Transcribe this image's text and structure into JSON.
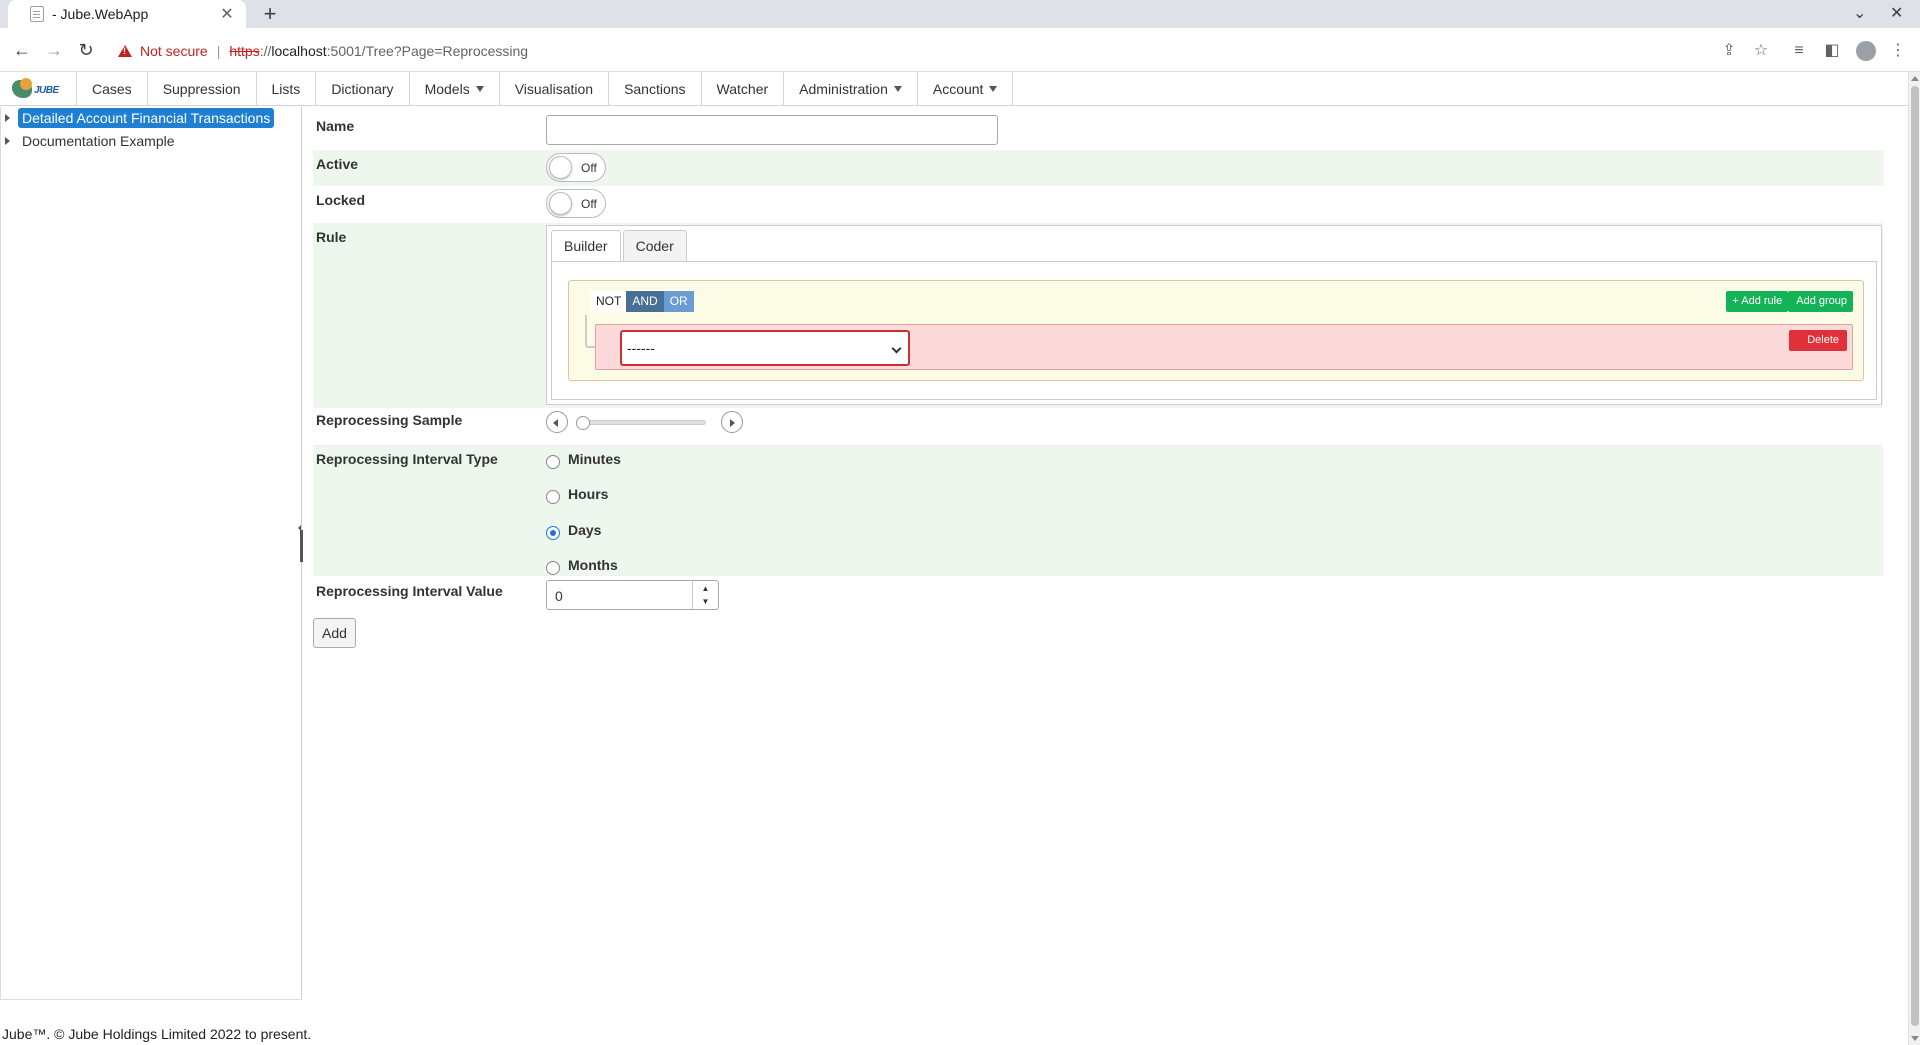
{
  "browser": {
    "tab_title": "- Jube.WebApp",
    "tab_close": "✕",
    "new_tab": "+",
    "security_label": "Not secure",
    "url_scheme": "https",
    "url_sep": "://",
    "url_host": "localhost",
    "url_path": ":5001/Tree?Page=Reprocessing"
  },
  "app": {
    "logo_text": "JUBE",
    "menu": [
      {
        "label": "Cases"
      },
      {
        "label": "Suppression"
      },
      {
        "label": "Lists"
      },
      {
        "label": "Dictionary"
      },
      {
        "label": "Models",
        "dropdown": true
      },
      {
        "label": "Visualisation"
      },
      {
        "label": "Sanctions"
      },
      {
        "label": "Watcher"
      },
      {
        "label": "Administration",
        "dropdown": true
      },
      {
        "label": "Account",
        "dropdown": true
      }
    ]
  },
  "tree": {
    "items": [
      {
        "label": "Detailed Account Financial Transactions",
        "selected": true
      },
      {
        "label": "Documentation Example",
        "selected": false
      }
    ]
  },
  "form": {
    "name": {
      "label": "Name",
      "value": ""
    },
    "active": {
      "label": "Active",
      "state": "Off"
    },
    "locked": {
      "label": "Locked",
      "state": "Off"
    },
    "rule": {
      "label": "Rule",
      "tabs": [
        "Builder",
        "Coder"
      ],
      "active_tab": "Builder",
      "not_label": "NOT",
      "and_label": "AND",
      "or_label": "OR",
      "add_rule": "+ Add rule",
      "add_group": "Add group",
      "field_select": "------",
      "delete": "Delete"
    },
    "reprocessing_sample": {
      "label": "Reprocessing Sample",
      "value": 0
    },
    "interval_type": {
      "label": "Reprocessing Interval Type",
      "options": [
        "Minutes",
        "Hours",
        "Days",
        "Months"
      ],
      "selected": "Days"
    },
    "interval_value": {
      "label": "Reprocessing Interval Value",
      "value": "0"
    },
    "add_button": "Add"
  },
  "footer": "Jube™. © Jube Holdings Limited 2022 to present.",
  "colors": {
    "selected_tree": "#1e7fd3",
    "shaded_row": "#eef7ee",
    "add_buttons": "#15b358",
    "delete_button": "#e0303a"
  }
}
